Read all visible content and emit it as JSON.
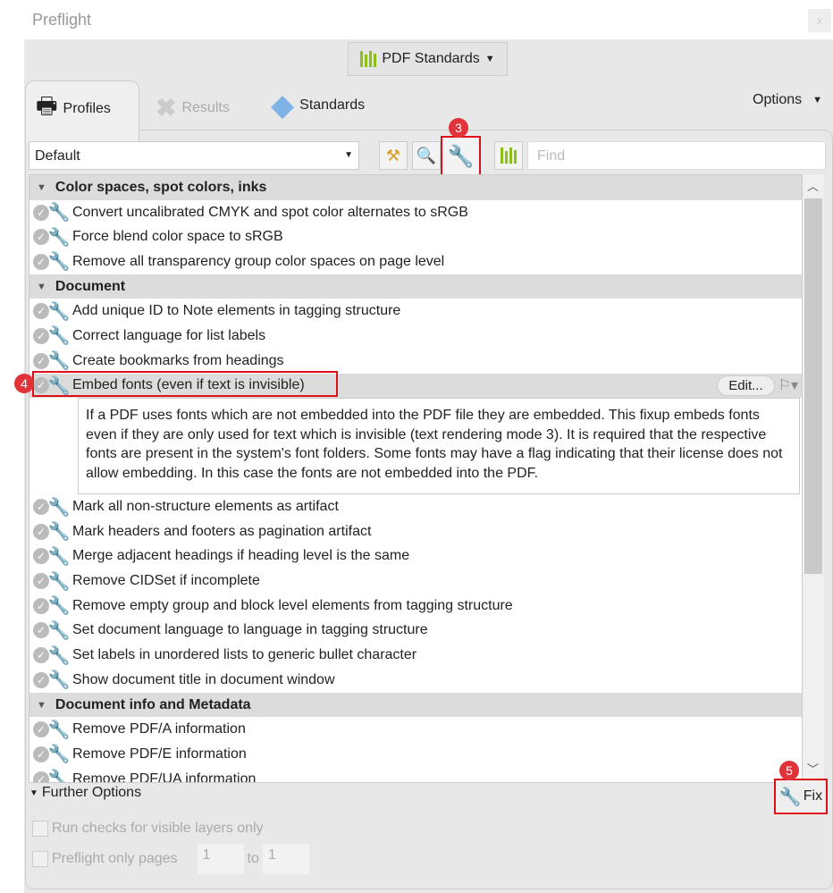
{
  "window": {
    "title": "Preflight",
    "close": "x"
  },
  "standards_button": {
    "label": "PDF Standards",
    "icon": "bar-chart-icon"
  },
  "tabs": [
    {
      "label": "Profiles"
    },
    {
      "label": "Results"
    },
    {
      "label": "Standards"
    }
  ],
  "options_label": "Options",
  "profile_select": {
    "value": "Default"
  },
  "find": {
    "placeholder": "Find"
  },
  "badges": {
    "b3": "3",
    "b4": "4",
    "b5": "5"
  },
  "list": {
    "sections": [
      {
        "title": "Color spaces, spot colors, inks",
        "items": [
          "Convert uncalibrated CMYK and spot color alternates to sRGB",
          "Force blend color space to sRGB",
          "Remove all transparency group color spaces on page level"
        ]
      },
      {
        "title": "Document",
        "items_before": [
          "Add unique ID to Note elements in tagging structure",
          "Correct language for list labels",
          "Create bookmarks from headings"
        ],
        "selected": {
          "label": "Embed fonts (even if text is invisible)",
          "edit": "Edit...",
          "description": "If a PDF uses fonts which are not embedded into the PDF file they are embedded. This fixup embeds fonts even if they are only used for text which is invisible (text rendering mode 3). It is required that the respective fonts are present in the system's font folders. Some fonts may have a flag indicating that their license does not allow embedding. In this case the fonts are not embedded into the PDF."
        },
        "items_after": [
          "Mark all non-structure elements as artifact",
          "Mark headers and footers as pagination artifact",
          "Merge adjacent headings if heading level is the same",
          "Remove CIDSet if incomplete",
          "Remove empty group and block level elements from tagging structure",
          "Set document language to language in tagging structure",
          "Set labels in unordered lists to generic bullet character",
          "Show document title in document window"
        ]
      },
      {
        "title": "Document info and Metadata",
        "items": [
          "Remove PDF/A information",
          "Remove PDF/E information",
          "Remove PDF/UA information"
        ]
      }
    ]
  },
  "further_options": {
    "label": "Further Options",
    "visible_layers": "Run checks for visible layers only",
    "only_pages": "Preflight only pages",
    "from": "1",
    "to_label": "to",
    "to": "1"
  },
  "fix_button": {
    "label": "Fix"
  }
}
